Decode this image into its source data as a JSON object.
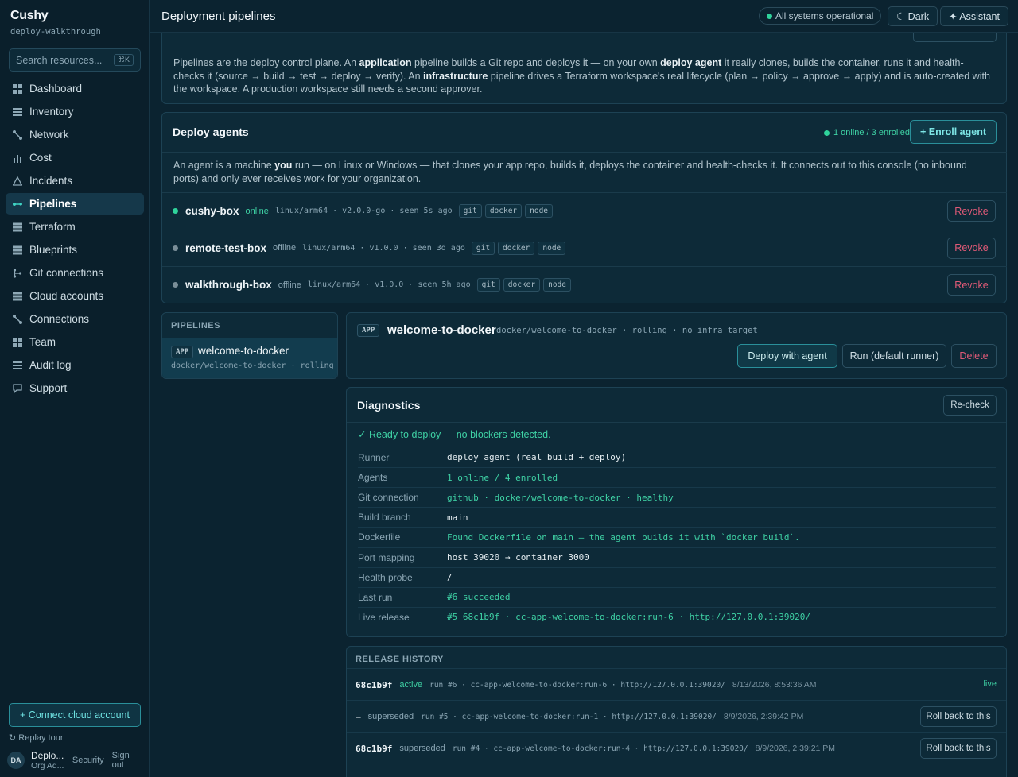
{
  "brand": {
    "name": "Cushy",
    "workspace": "deploy-walkthrough"
  },
  "search": {
    "placeholder": "Search resources...",
    "shortcut": "⌘K"
  },
  "nav": [
    {
      "label": "Dashboard",
      "icon": "grid-icon"
    },
    {
      "label": "Inventory",
      "icon": "list-icon"
    },
    {
      "label": "Network",
      "icon": "network-icon"
    },
    {
      "label": "Cost",
      "icon": "bar-chart-icon"
    },
    {
      "label": "Incidents",
      "icon": "warning-icon"
    },
    {
      "label": "Pipelines",
      "icon": "pipeline-icon",
      "active": true
    },
    {
      "label": "Terraform",
      "icon": "stack-icon"
    },
    {
      "label": "Blueprints",
      "icon": "stack-icon"
    },
    {
      "label": "Git connections",
      "icon": "git-branch-icon"
    },
    {
      "label": "Cloud accounts",
      "icon": "stack-icon"
    },
    {
      "label": "Connections",
      "icon": "network-icon"
    },
    {
      "label": "Team",
      "icon": "grid-icon"
    },
    {
      "label": "Audit log",
      "icon": "list-icon"
    },
    {
      "label": "Support",
      "icon": "chat-icon"
    }
  ],
  "sidebar_footer": {
    "connect_label": "+ Connect cloud account",
    "replay_label": "Replay tour",
    "user_initials": "DA",
    "user_name": "Deplo...",
    "user_role": "Org Ad...",
    "security_label": "Security",
    "signout_label": "Sign out"
  },
  "header": {
    "title": "Deployment pipelines",
    "status": "All systems operational",
    "theme_label": "☾ Dark",
    "assistant_label": "✦ Assistant"
  },
  "intro": {
    "p1": "Pipelines are the deploy control plane. An ",
    "b1": "application",
    "p2": " pipeline builds a Git repo and deploys it — on your own ",
    "b2": "deploy agent",
    "p3": " it really clones, builds the container, runs it and health-checks it (source → build → test → deploy → verify). An ",
    "b3": "infrastructure",
    "p4": " pipeline drives a Terraform workspace's real lifecycle (plan → policy → approve → apply) and is auto-created with the workspace. A production workspace still needs a second approver."
  },
  "agents": {
    "title": "Deploy agents",
    "status": "1 online / 3 enrolled",
    "enroll_label": "+ Enroll agent",
    "desc_a": "An agent is a machine ",
    "desc_b": "you",
    "desc_c": " run — on Linux or Windows — that clones your app repo, builds it, deploys the container and health-checks it. It connects out to this console (no inbound ports) and only ever receives work for your organization.",
    "revoke_label": "Revoke",
    "rows": [
      {
        "name": "cushy-box",
        "state": "online",
        "meta": "linux/arm64 · v2.0.0-go · seen 5s ago",
        "tags": [
          "git",
          "docker",
          "node"
        ]
      },
      {
        "name": "remote-test-box",
        "state": "offline",
        "meta": "linux/arm64 · v1.0.0 · seen 3d ago",
        "tags": [
          "git",
          "docker",
          "node"
        ]
      },
      {
        "name": "walkthrough-box",
        "state": "offline",
        "meta": "linux/arm64 · v1.0.0 · seen 5h ago",
        "tags": [
          "git",
          "docker",
          "node"
        ]
      }
    ]
  },
  "pipelines": {
    "label": "PIPELINES",
    "item_badge": "APP",
    "item_name": "welcome-to-docker",
    "item_meta": "docker/welcome-to-docker · rolling"
  },
  "pipeline_detail": {
    "badge": "APP",
    "name": "welcome-to-docker",
    "meta": "docker/welcome-to-docker · rolling · no infra target",
    "deploy_label": "Deploy with agent",
    "run_label": "Run (default runner)",
    "delete_label": "Delete"
  },
  "diagnostics": {
    "title": "Diagnostics",
    "recheck_label": "Re-check",
    "ready": "✓ Ready to deploy — no blockers detected.",
    "rows": [
      {
        "key": "Runner",
        "value": "deploy agent (real build + deploy)",
        "tone": "plain"
      },
      {
        "key": "Agents",
        "value": "1 online / 4 enrolled",
        "tone": "ok"
      },
      {
        "key": "Git connection",
        "value": "github · docker/welcome-to-docker · healthy",
        "tone": "ok"
      },
      {
        "key": "Build branch",
        "value": "main",
        "tone": "plain"
      },
      {
        "key": "Dockerfile",
        "value": "Found Dockerfile on main — the agent builds it with `docker build`.",
        "tone": "ok"
      },
      {
        "key": "Port mapping",
        "value": "host 39020 → container 3000",
        "tone": "plain"
      },
      {
        "key": "Health probe",
        "value": "/",
        "tone": "plain"
      },
      {
        "key": "Last run",
        "value": "#6 succeeded",
        "tone": "ok"
      },
      {
        "key": "Live release",
        "value": "#5 68c1b9f · cc-app-welcome-to-docker:run-6 · http://127.0.0.1:39020/",
        "tone": "ok"
      }
    ]
  },
  "releases": {
    "label": "RELEASE HISTORY",
    "rollback_label": "Roll back to this",
    "live_label": "live",
    "rows": [
      {
        "sha": "68c1b9f",
        "status": "active",
        "meta": "run #6 · cc-app-welcome-to-docker:run-6 · http://127.0.0.1:39020/",
        "time": "8/13/2026, 8:53:36 AM"
      },
      {
        "sha": "–",
        "status": "superseded",
        "meta": "run #5 · cc-app-welcome-to-docker:run-1 · http://127.0.0.1:39020/",
        "time": "8/9/2026, 2:39:42 PM"
      },
      {
        "sha": "68c1b9f",
        "status": "superseded",
        "meta": "run #4 · cc-app-welcome-to-docker:run-4 · http://127.0.0.1:39020/",
        "time": "8/9/2026, 2:39:21 PM"
      }
    ]
  },
  "colors": {
    "accent": "#3fd2c3",
    "ok": "#3fd2a5",
    "danger": "#e05a77",
    "offline": "#7a8e98"
  }
}
